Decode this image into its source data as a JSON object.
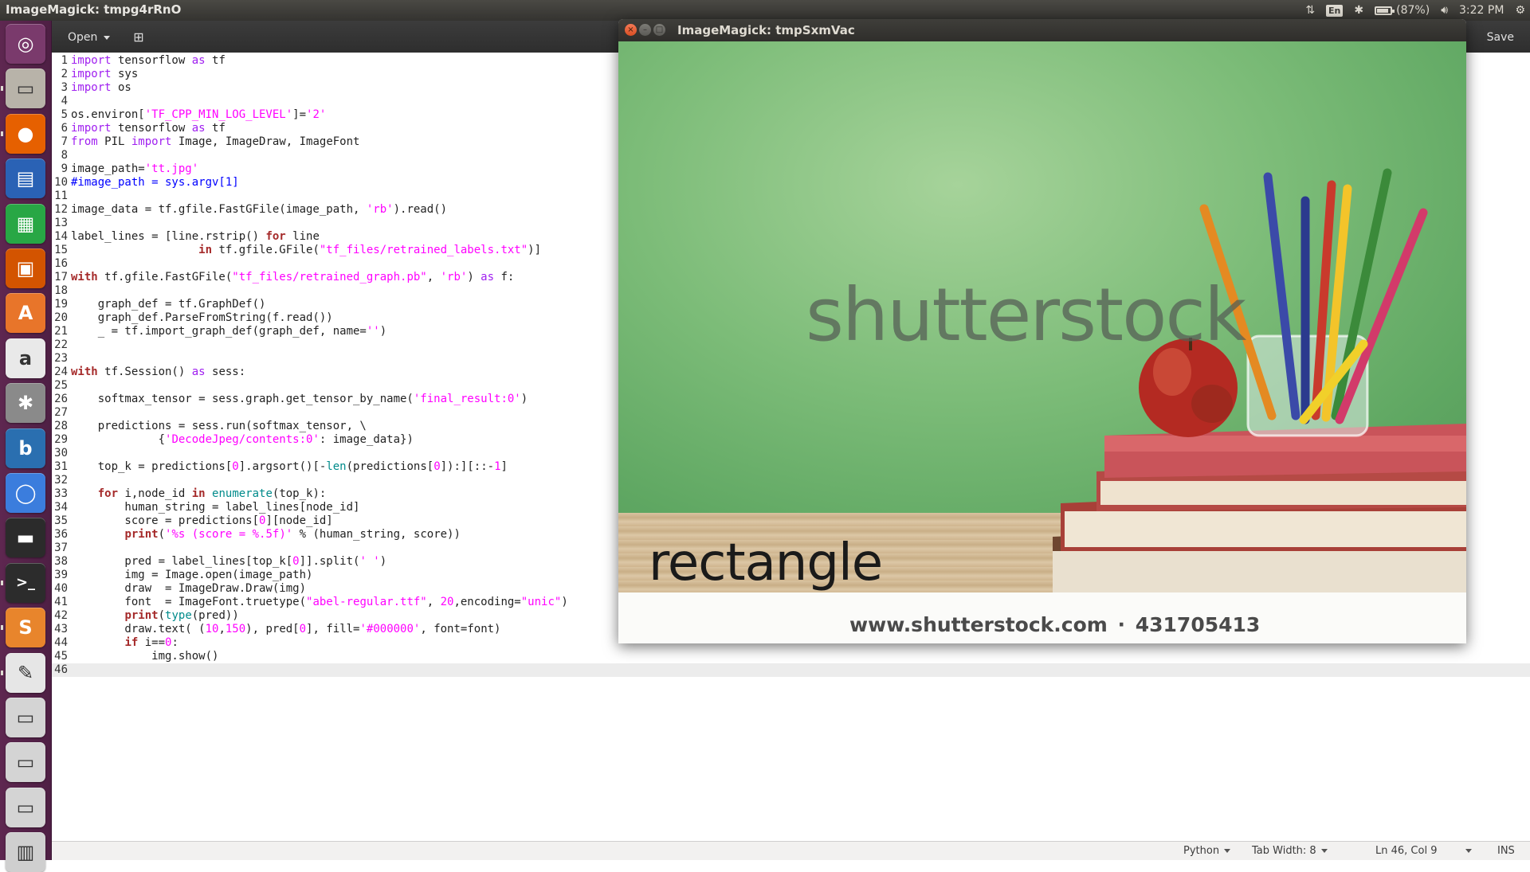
{
  "top_panel": {
    "window_title": "ImageMagick: tmpg4rRnO",
    "keyboard_layout": "En",
    "battery": "(87%)",
    "battery_fraction": 0.87,
    "time": "3:22 PM"
  },
  "launcher": {
    "items": [
      {
        "name": "ubuntu-dash-icon",
        "glyph": "◎",
        "bg": "#7a3a6c"
      },
      {
        "name": "files-icon",
        "glyph": "▭",
        "bg": "#b8b3a9"
      },
      {
        "name": "firefox-icon",
        "glyph": "●",
        "bg": "#e66000"
      },
      {
        "name": "libreoffice-writer-icon",
        "glyph": "▤",
        "bg": "#2a62b5"
      },
      {
        "name": "libreoffice-calc-icon",
        "glyph": "▦",
        "bg": "#28a745"
      },
      {
        "name": "libreoffice-impress-icon",
        "glyph": "▣",
        "bg": "#d35400"
      },
      {
        "name": "software-center-icon",
        "glyph": "A",
        "bg": "#e8752a"
      },
      {
        "name": "amazon-icon",
        "glyph": "a",
        "bg": "#e9e9e9"
      },
      {
        "name": "system-settings-icon",
        "glyph": "✱",
        "bg": "#8a8a8a"
      },
      {
        "name": "bing-icon",
        "glyph": "b",
        "bg": "#2a6fb0"
      },
      {
        "name": "chromium-icon",
        "glyph": "◯",
        "bg": "#3b7ddd"
      },
      {
        "name": "monitor-icon",
        "glyph": "▬",
        "bg": "#2b2b2b"
      },
      {
        "name": "terminal-icon",
        "glyph": ">_",
        "bg": "#2c2c2c"
      },
      {
        "name": "sublime-text-icon",
        "glyph": "S",
        "bg": "#e8852c"
      },
      {
        "name": "text-editor-icon",
        "glyph": "✎",
        "bg": "#e6e6e6"
      },
      {
        "name": "disk-drive-icon",
        "glyph": "▭",
        "bg": "#d4d4d4"
      },
      {
        "name": "disk-drive-2-icon",
        "glyph": "▭",
        "bg": "#d4d4d4"
      },
      {
        "name": "disk-drive-3-icon",
        "glyph": "▭",
        "bg": "#d4d4d4"
      },
      {
        "name": "trash-icon",
        "glyph": "▥",
        "bg": "#cfcfcf"
      }
    ]
  },
  "editor": {
    "open_label": "Open",
    "save_label": "Save",
    "lines": [
      {
        "n": "1",
        "h": "<span class=\"imp\">import</span> tensorflow <span class=\"imp\">as</span> tf"
      },
      {
        "n": "2",
        "h": "<span class=\"imp\">import</span> sys"
      },
      {
        "n": "3",
        "h": "<span class=\"imp\">import</span> os"
      },
      {
        "n": "4",
        "h": ""
      },
      {
        "n": "5",
        "h": "os.environ[<span class=\"str\">'TF_CPP_MIN_LOG_LEVEL'</span>]=<span class=\"str\">'2'</span>"
      },
      {
        "n": "6",
        "h": "<span class=\"imp\">import</span> tensorflow <span class=\"imp\">as</span> tf"
      },
      {
        "n": "7",
        "h": "<span class=\"imp\">from</span> PIL <span class=\"imp\">import</span> Image, ImageDraw, ImageFont"
      },
      {
        "n": "8",
        "h": ""
      },
      {
        "n": "9",
        "h": "image_path=<span class=\"str\">'tt.jpg'</span>"
      },
      {
        "n": "10",
        "h": "<span class=\"cm\">#image_path = sys.argv[1]</span>"
      },
      {
        "n": "11",
        "h": ""
      },
      {
        "n": "12",
        "h": "image_data = tf.gfile.FastGFile(image_path, <span class=\"str\">'rb'</span>).read()"
      },
      {
        "n": "13",
        "h": ""
      },
      {
        "n": "14",
        "h": "label_lines = [line.rstrip() <span class=\"kw\">for</span> line"
      },
      {
        "n": "15",
        "h": "                   <span class=\"kw\">in</span> tf.gfile.GFile(<span class=\"str\">\"tf_files/retrained_labels.txt\"</span>)]"
      },
      {
        "n": "16",
        "h": ""
      },
      {
        "n": "17",
        "h": "<span class=\"kw\">with</span> tf.gfile.FastGFile(<span class=\"str\">\"tf_files/retrained_graph.pb\"</span>, <span class=\"str\">'rb'</span>) <span class=\"imp\">as</span> f:"
      },
      {
        "n": "18",
        "h": ""
      },
      {
        "n": "19",
        "h": "    graph_def = tf.GraphDef()"
      },
      {
        "n": "20",
        "h": "    graph_def.ParseFromString(f.read())"
      },
      {
        "n": "21",
        "h": "    _ = tf.import_graph_def(graph_def, name=<span class=\"str\">''</span>)"
      },
      {
        "n": "22",
        "h": ""
      },
      {
        "n": "23",
        "h": ""
      },
      {
        "n": "24",
        "h": "<span class=\"kw\">with</span> tf.Session() <span class=\"imp\">as</span> sess:"
      },
      {
        "n": "25",
        "h": ""
      },
      {
        "n": "26",
        "h": "    softmax_tensor = sess.graph.get_tensor_by_name(<span class=\"str\">'final_result:0'</span>)"
      },
      {
        "n": "27",
        "h": ""
      },
      {
        "n": "28",
        "h": "    predictions = sess.run(softmax_tensor, \\"
      },
      {
        "n": "29",
        "h": "             {<span class=\"str\">'DecodeJpeg/contents:0'</span>: image_data})"
      },
      {
        "n": "30",
        "h": ""
      },
      {
        "n": "31",
        "h": "    top_k = predictions[<span class=\"num\">0</span>].argsort()[-<span class=\"bi\">len</span>(predictions[<span class=\"num\">0</span>]):][::-<span class=\"num\">1</span>]"
      },
      {
        "n": "32",
        "h": ""
      },
      {
        "n": "33",
        "h": "    <span class=\"kw\">for</span> i,node_id <span class=\"kw\">in</span> <span class=\"bi\">enumerate</span>(top_k):"
      },
      {
        "n": "34",
        "h": "        human_string = label_lines[node_id]"
      },
      {
        "n": "35",
        "h": "        score = predictions[<span class=\"num\">0</span>][node_id]"
      },
      {
        "n": "36",
        "h": "        <span class=\"kw\">print</span>(<span class=\"str\">'%s (score = %.5f)'</span> % (human_string, score))"
      },
      {
        "n": "37",
        "h": ""
      },
      {
        "n": "38",
        "h": "        pred = label_lines[top_k[<span class=\"num\">0</span>]].split(<span class=\"str\">' '</span>)"
      },
      {
        "n": "39",
        "h": "        img = Image.open(image_path)"
      },
      {
        "n": "40",
        "h": "        draw  = ImageDraw.Draw(img)"
      },
      {
        "n": "41",
        "h": "        font  = ImageFont.truetype(<span class=\"str\">\"abel-regular.ttf\"</span>, <span class=\"num\">20</span>,encoding=<span class=\"str\">\"unic\"</span>)"
      },
      {
        "n": "42",
        "h": "        <span class=\"kw\">print</span>(<span class=\"bi\">type</span>(pred))"
      },
      {
        "n": "43",
        "h": "        draw.text( (<span class=\"num\">10</span>,<span class=\"num\">150</span>), pred[<span class=\"num\">0</span>], fill=<span class=\"str\">'#000000'</span>, font=font)"
      },
      {
        "n": "44",
        "h": "        <span class=\"kw\">if</span> i==<span class=\"num\">0</span>:"
      },
      {
        "n": "45",
        "h": "            img.show()"
      },
      {
        "n": "46",
        "h": ""
      }
    ],
    "current_line": "46"
  },
  "status_bar": {
    "language": "Python",
    "tab_width": "Tab Width: 8",
    "position": "Ln 46, Col 9",
    "mode": "INS"
  },
  "image_window": {
    "title": "ImageMagick: tmpSxmVac",
    "watermark": "shutterstock",
    "overlay_label": "rectangle",
    "stock_url": "www.shutterstock.com · 431705413"
  }
}
